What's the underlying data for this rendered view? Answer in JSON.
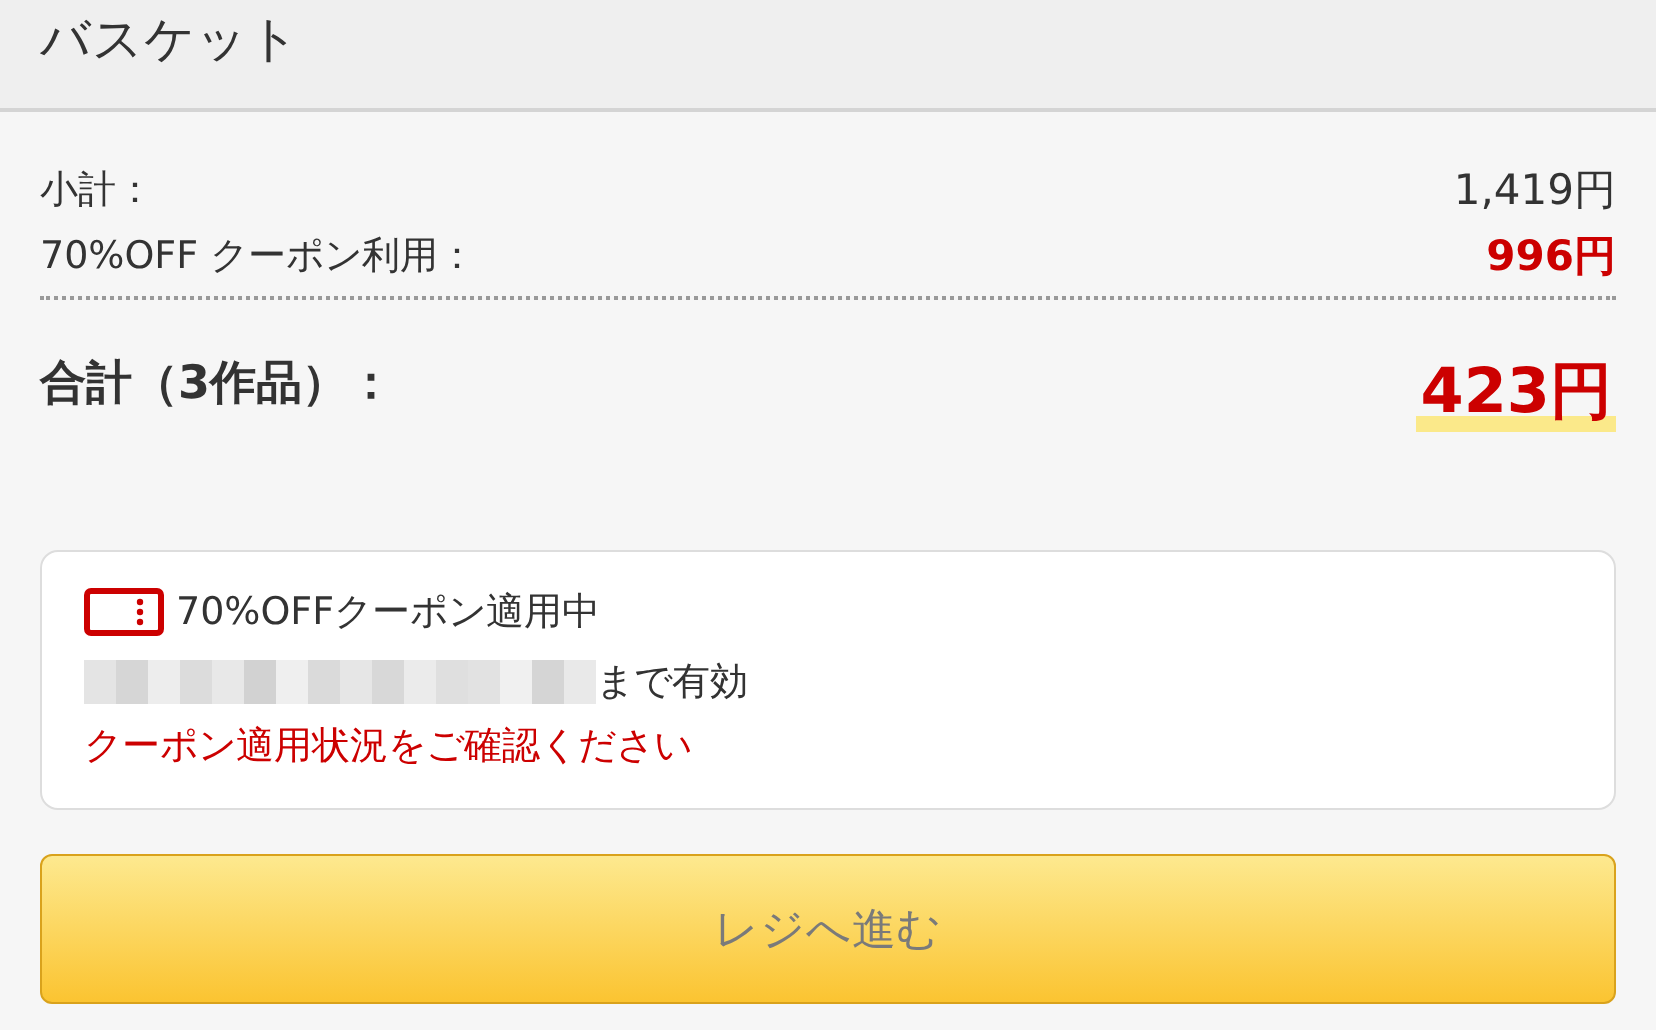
{
  "header": {
    "title": "バスケット"
  },
  "summary": [
    {
      "label": "小計：",
      "value": "1,419円",
      "kind": "plain"
    },
    {
      "label": "70%OFF クーポン利用：",
      "value": "996円",
      "kind": "discount"
    }
  ],
  "total": {
    "label": "合計（3作品）：",
    "value": "423円"
  },
  "coupon": {
    "title": "70%OFFクーポン適用中",
    "validity": "まで有効",
    "notice": "クーポン適用状況をご確認ください"
  },
  "checkout": {
    "label": "レジへ進む",
    "disabled": true
  }
}
